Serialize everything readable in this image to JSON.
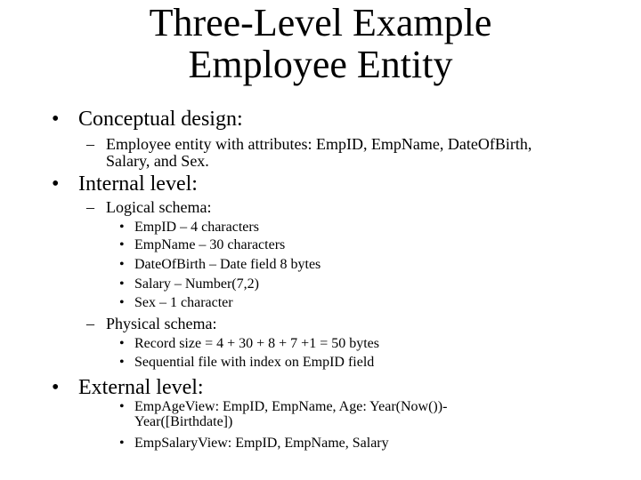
{
  "title_line1": "Three-Level Example",
  "title_line2": "Employee Entity",
  "bullet_l1": "•",
  "bullet_l2": "–",
  "bullet_l3": "•",
  "sections": {
    "conceptual": {
      "heading": "Conceptual design:",
      "item_line1": "Employee entity with attributes: EmpID, EmpName, DateOfBirth,",
      "item_line2": "Salary, and Sex."
    },
    "internal": {
      "heading": "Internal level:",
      "logical": {
        "heading": "Logical schema:",
        "items": [
          "EmpID – 4 characters",
          "EmpName – 30 characters",
          "DateOfBirth – Date field 8 bytes",
          "Salary – Number(7,2)",
          "Sex – 1 character"
        ]
      },
      "physical": {
        "heading": "Physical schema:",
        "items": [
          "Record size = 4 + 30 + 8 + 7 +1 = 50 bytes",
          "Sequential file with index on EmpID field"
        ]
      }
    },
    "external": {
      "heading": "External level:",
      "view1_line1": "EmpAgeView: EmpID, EmpName, Age: Year(Now())-",
      "view1_line2": "Year([Birthdate])",
      "view2": "EmpSalaryView: EmpID, EmpName, Salary"
    }
  }
}
